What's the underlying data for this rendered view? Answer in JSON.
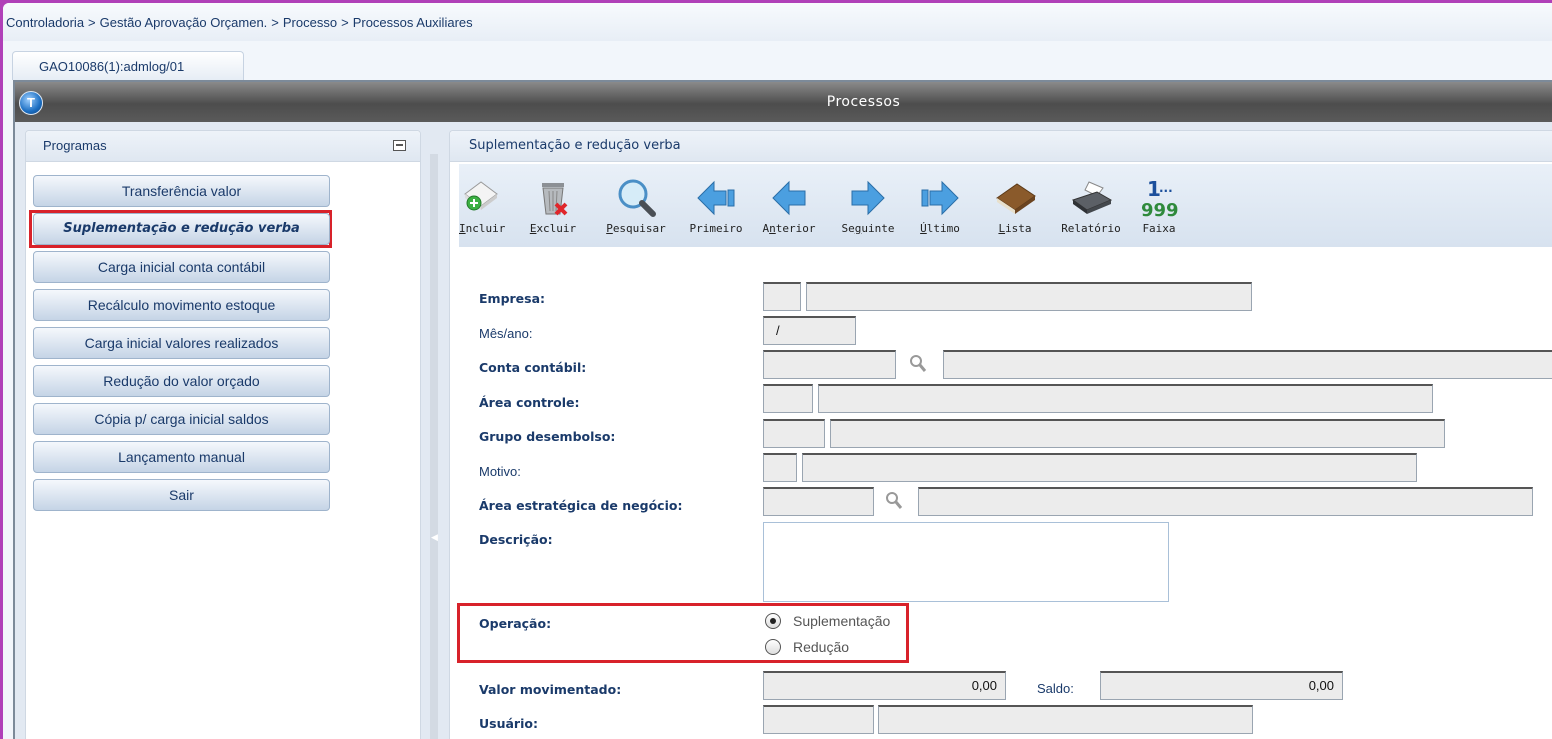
{
  "breadcrumb": [
    "Controladoria",
    ">",
    "Gestão Aprovação Orçamen.",
    ">",
    "Processo",
    ">",
    "Processos Auxiliares"
  ],
  "tab": {
    "label": "GAO10086(1):admlog/01"
  },
  "window": {
    "title": "Processos",
    "logo": "T"
  },
  "left_panel": {
    "title": "Programas",
    "items": [
      {
        "label": "Transferência valor"
      },
      {
        "label": "Suplementação e redução verba",
        "selected": true
      },
      {
        "label": "Carga inicial conta contábil"
      },
      {
        "label": "Recálculo movimento estoque"
      },
      {
        "label": "Carga inicial valores realizados"
      },
      {
        "label": "Redução do valor orçado"
      },
      {
        "label": "Cópia p/ carga inicial saldos"
      },
      {
        "label": "Lançamento manual"
      },
      {
        "label": "Sair"
      }
    ]
  },
  "right_panel": {
    "title": "Suplementação e redução verba",
    "toolbar": [
      {
        "label": "Incluir",
        "icon": "add-document-icon"
      },
      {
        "label": "Excluir",
        "icon": "trash-delete-icon"
      },
      {
        "label": "Pesquisar",
        "icon": "magnifier-icon"
      },
      {
        "label": "Primeiro",
        "icon": "first-arrow-icon"
      },
      {
        "label": "Anterior",
        "icon": "previous-arrow-icon"
      },
      {
        "label": "Seguinte",
        "icon": "next-arrow-icon"
      },
      {
        "label": "Último",
        "icon": "last-arrow-icon"
      },
      {
        "label": "Lista",
        "icon": "book-list-icon"
      },
      {
        "label": "Relatório",
        "icon": "printer-icon"
      },
      {
        "label": "Faixa",
        "icon": "range-numbers-icon"
      }
    ],
    "form": {
      "empresa": "Empresa:",
      "mes_ano": "Mês/ano:",
      "mes_ano_value": "/",
      "conta_contabil": "Conta contábil:",
      "area_controle": "Área controle:",
      "grupo_desembolso": "Grupo desembolso:",
      "motivo": "Motivo:",
      "area_estrategica": "Área estratégica de negócio:",
      "descricao": "Descrição:",
      "operacao": "Operação:",
      "operacao_options": [
        {
          "label": "Suplementação",
          "checked": true
        },
        {
          "label": "Redução",
          "checked": false
        }
      ],
      "valor_movimentado": "Valor movimentado:",
      "valor_movimentado_value": "0,00",
      "saldo": "Saldo:",
      "saldo_value": "0,00",
      "usuario": "Usuário:"
    }
  },
  "colors": {
    "highlight": "#d8222a",
    "frame": "#b040b8",
    "label": "#1a3a6a"
  }
}
